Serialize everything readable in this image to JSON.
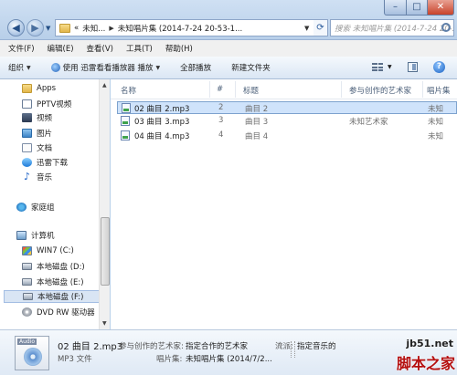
{
  "address": {
    "overflow": "«",
    "crumbs": [
      "未知...",
      "未知唱片集 (2014-7-24 20-53-1..."
    ],
    "search_placeholder": "搜索 未知唱片集 (2014-7-24 20-53-..."
  },
  "menu": [
    "文件(F)",
    "编辑(E)",
    "查看(V)",
    "工具(T)",
    "帮助(H)"
  ],
  "toolbar": {
    "organize": "组织",
    "play_with": "使用 迅雷看看播放器 播放",
    "play_all": "全部播放",
    "new_folder": "新建文件夹"
  },
  "nav": {
    "favorites": [
      "Apps",
      "PPTV视频",
      "视频",
      "图片",
      "文档",
      "迅雷下载",
      "音乐"
    ],
    "homegroup": "家庭组",
    "computer": "计算机",
    "drives": [
      "WIN7 (C:)",
      "本地磁盘 (D:)",
      "本地磁盘 (E:)",
      "本地磁盘 (F:)",
      "DVD RW 驱动器"
    ]
  },
  "columns": [
    "名称",
    "#",
    "标题",
    "参与创作的艺术家",
    "唱片集"
  ],
  "files": [
    {
      "name": "02 曲目 2.mp3",
      "num": "2",
      "title": "曲目 2",
      "artist": "",
      "album": "未知"
    },
    {
      "name": "03 曲目 3.mp3",
      "num": "3",
      "title": "曲目 3",
      "artist": "未知艺术家",
      "album": "未知"
    },
    {
      "name": "04 曲目 4.mp3",
      "num": "4",
      "title": "曲目 4",
      "artist": "",
      "album": "未知"
    }
  ],
  "details": {
    "thumb_label": "Audio",
    "filename": "02 曲目 2.mp3",
    "filetype": "MP3 文件",
    "artist_label": "参与创作的艺术家:",
    "artist_value": "指定合作的艺术家",
    "album_label": "唱片集:",
    "album_value": "未知唱片集 (2014/7/2...",
    "genre_label": "流派:",
    "genre_value": "指定音乐的"
  },
  "watermark": {
    "top": "jb51.net",
    "bottom": "脚本之家"
  }
}
